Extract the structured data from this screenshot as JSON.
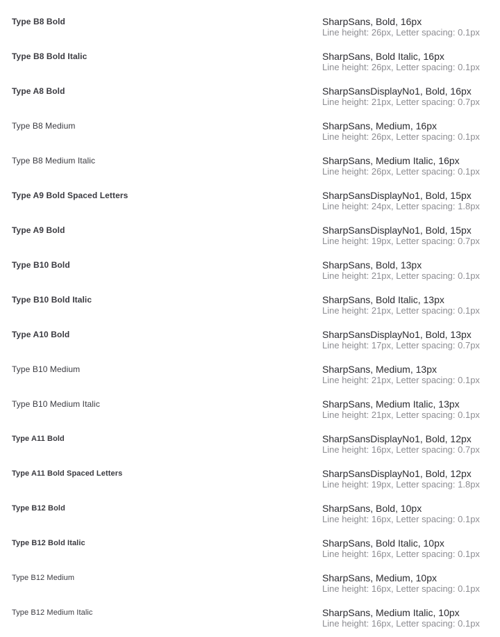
{
  "styles": [
    {
      "name": "Type B8 Bold",
      "weight": "bold",
      "size": "normal",
      "font": "SharpSans, Bold, 16px",
      "metrics": "Line height: 26px, Letter spacing: 0.1px"
    },
    {
      "name": "Type B8 Bold Italic",
      "weight": "bold",
      "size": "normal",
      "font": "SharpSans, Bold Italic, 16px",
      "metrics": "Line height: 26px, Letter spacing: 0.1px"
    },
    {
      "name": "Type A8 Bold",
      "weight": "bold",
      "size": "normal",
      "font": "SharpSansDisplayNo1, Bold, 16px",
      "metrics": "Line height: 21px, Letter spacing: 0.7px"
    },
    {
      "name": "Type B8 Medium",
      "weight": "medium",
      "size": "normal",
      "font": "SharpSans, Medium, 16px",
      "metrics": "Line height: 26px, Letter spacing: 0.1px"
    },
    {
      "name": "Type B8 Medium Italic",
      "weight": "medium",
      "size": "normal",
      "font": "SharpSans, Medium Italic, 16px",
      "metrics": "Line height: 26px, Letter spacing: 0.1px"
    },
    {
      "name": "Type A9 Bold Spaced Letters",
      "weight": "bold",
      "size": "normal",
      "font": "SharpSansDisplayNo1, Bold, 15px",
      "metrics": "Line height: 24px, Letter spacing: 1.8px"
    },
    {
      "name": "Type A9 Bold",
      "weight": "bold",
      "size": "normal",
      "font": "SharpSansDisplayNo1, Bold, 15px",
      "metrics": "Line height: 19px, Letter spacing: 0.7px"
    },
    {
      "name": "Type B10 Bold",
      "weight": "bold",
      "size": "normal",
      "font": "SharpSans, Bold, 13px",
      "metrics": "Line height: 21px, Letter spacing: 0.1px"
    },
    {
      "name": "Type B10 Bold Italic",
      "weight": "bold",
      "size": "normal",
      "font": "SharpSans, Bold Italic, 13px",
      "metrics": "Line height: 21px, Letter spacing: 0.1px"
    },
    {
      "name": "Type A10 Bold",
      "weight": "bold",
      "size": "normal",
      "font": "SharpSansDisplayNo1, Bold, 13px",
      "metrics": "Line height: 17px, Letter spacing: 0.7px"
    },
    {
      "name": "Type B10 Medium",
      "weight": "medium",
      "size": "normal",
      "font": "SharpSans, Medium, 13px",
      "metrics": "Line height: 21px, Letter spacing: 0.1px"
    },
    {
      "name": "Type B10 Medium Italic",
      "weight": "medium",
      "size": "normal",
      "font": "SharpSans, Medium Italic, 13px",
      "metrics": "Line height: 21px, Letter spacing: 0.1px"
    },
    {
      "name": "Type A11 Bold",
      "weight": "bold",
      "size": "small",
      "font": "SharpSansDisplayNo1, Bold, 12px",
      "metrics": "Line height: 16px, Letter spacing: 0.7px"
    },
    {
      "name": "Type A11 Bold Spaced Letters",
      "weight": "bold",
      "size": "small",
      "font": "SharpSansDisplayNo1, Bold, 12px",
      "metrics": "Line height: 19px, Letter spacing: 1.8px"
    },
    {
      "name": "Type B12 Bold",
      "weight": "bold",
      "size": "small",
      "font": "SharpSans, Bold, 10px",
      "metrics": "Line height: 16px, Letter spacing: 0.1px"
    },
    {
      "name": "Type B12 Bold Italic",
      "weight": "bold",
      "size": "small",
      "font": "SharpSans, Bold Italic, 10px",
      "metrics": "Line height: 16px, Letter spacing: 0.1px"
    },
    {
      "name": "Type B12 Medium",
      "weight": "medium",
      "size": "small",
      "font": "SharpSans, Medium, 10px",
      "metrics": "Line height: 16px, Letter spacing: 0.1px"
    },
    {
      "name": "Type B12 Medium Italic",
      "weight": "medium",
      "size": "small",
      "font": "SharpSans, Medium Italic, 10px",
      "metrics": "Line height: 16px, Letter spacing: 0.1px"
    }
  ]
}
